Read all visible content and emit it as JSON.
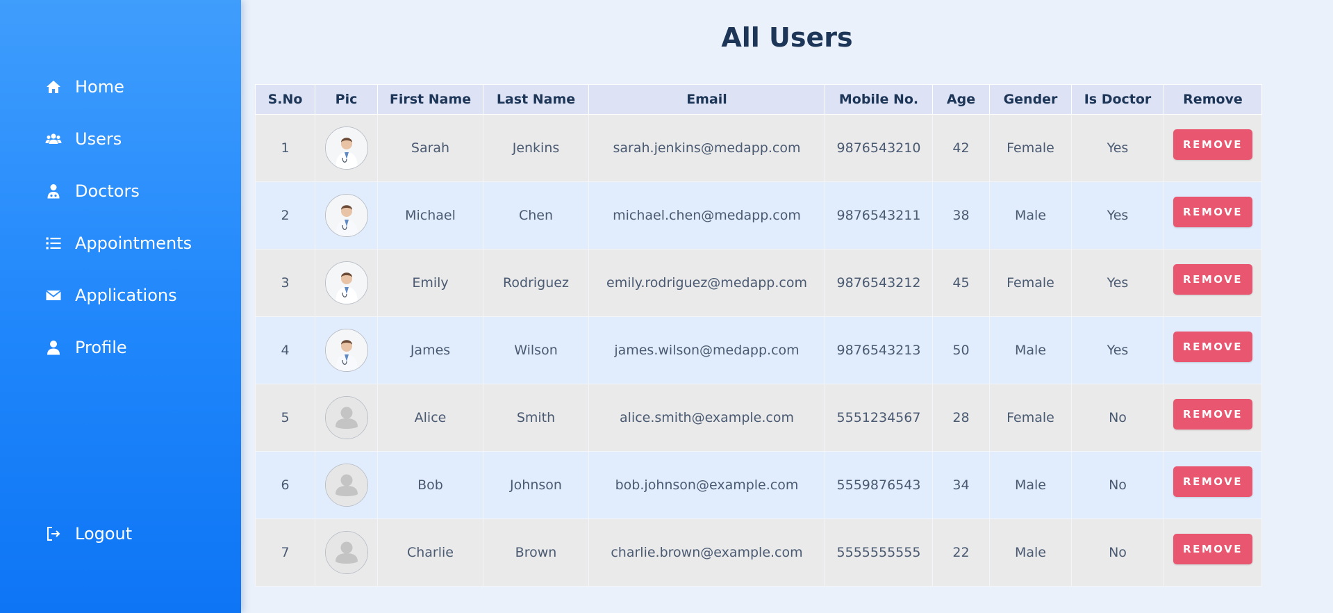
{
  "sidebar": {
    "items": [
      {
        "label": "Home",
        "icon": "home-icon"
      },
      {
        "label": "Users",
        "icon": "users-icon"
      },
      {
        "label": "Doctors",
        "icon": "doctor-icon"
      },
      {
        "label": "Appointments",
        "icon": "list-icon"
      },
      {
        "label": "Applications",
        "icon": "envelope-icon"
      },
      {
        "label": "Profile",
        "icon": "user-icon"
      }
    ],
    "logout": {
      "label": "Logout",
      "icon": "logout-icon"
    }
  },
  "main": {
    "title": "All Users",
    "table": {
      "headers": [
        "S.No",
        "Pic",
        "First Name",
        "Last Name",
        "Email",
        "Mobile No.",
        "Age",
        "Gender",
        "Is Doctor",
        "Remove"
      ],
      "remove_label": "REMOVE",
      "rows": [
        {
          "sno": "1",
          "pic": "doctor-photo",
          "first": "Sarah",
          "last": "Jenkins",
          "email": "sarah.jenkins@medapp.com",
          "mobile": "9876543210",
          "age": "42",
          "gender": "Female",
          "doctor": "Yes"
        },
        {
          "sno": "2",
          "pic": "doctor-photo",
          "first": "Michael",
          "last": "Chen",
          "email": "michael.chen@medapp.com",
          "mobile": "9876543211",
          "age": "38",
          "gender": "Male",
          "doctor": "Yes"
        },
        {
          "sno": "3",
          "pic": "doctor-photo",
          "first": "Emily",
          "last": "Rodriguez",
          "email": "emily.rodriguez@medapp.com",
          "mobile": "9876543212",
          "age": "45",
          "gender": "Female",
          "doctor": "Yes"
        },
        {
          "sno": "4",
          "pic": "doctor-photo",
          "first": "James",
          "last": "Wilson",
          "email": "james.wilson@medapp.com",
          "mobile": "9876543213",
          "age": "50",
          "gender": "Male",
          "doctor": "Yes"
        },
        {
          "sno": "5",
          "pic": "default-avatar",
          "first": "Alice",
          "last": "Smith",
          "email": "alice.smith@example.com",
          "mobile": "5551234567",
          "age": "28",
          "gender": "Female",
          "doctor": "No"
        },
        {
          "sno": "6",
          "pic": "default-avatar",
          "first": "Bob",
          "last": "Johnson",
          "email": "bob.johnson@example.com",
          "mobile": "5559876543",
          "age": "34",
          "gender": "Male",
          "doctor": "No"
        },
        {
          "sno": "7",
          "pic": "default-avatar",
          "first": "Charlie",
          "last": "Brown",
          "email": "charlie.brown@example.com",
          "mobile": "5555555555",
          "age": "22",
          "gender": "Male",
          "doctor": "No"
        }
      ]
    }
  },
  "colors": {
    "sidebar_top": "#3f9dfc",
    "sidebar_bottom": "#0e75f5",
    "page_background": "#eaf1fb",
    "title": "#1d3557",
    "header_background": "#dde3f5",
    "row_odd": "#eaeaea",
    "row_even": "#e1edfc",
    "remove_button": "#e8566f"
  }
}
